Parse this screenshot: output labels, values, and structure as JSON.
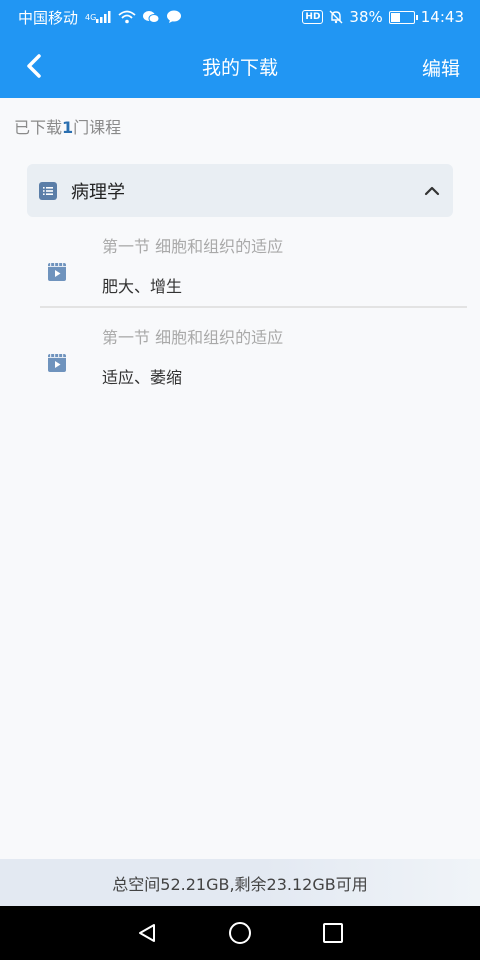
{
  "statusbar": {
    "carrier": "中国移动",
    "network": "4G",
    "battery_percent": "38%",
    "time": "14:43",
    "hd": "HD"
  },
  "header": {
    "title": "我的下载",
    "edit_label": "编辑",
    "back_icon": "chevron-left-icon"
  },
  "summary": {
    "prefix": "已下载",
    "count": "1",
    "suffix": "门课程"
  },
  "course": {
    "title": "病理学",
    "icon": "list-icon",
    "expanded": true
  },
  "lessons": [
    {
      "chapter": "第一节 细胞和组织的适应",
      "name": "肥大、增生"
    },
    {
      "chapter": "第一节 细胞和组织的适应",
      "name": "适应、萎缩"
    }
  ],
  "footer": {
    "storage_text": "总空间52.21GB,剩余23.12GB可用"
  },
  "colors": {
    "accent": "#2196f3",
    "course_card": "#e9eef3",
    "icon_blue": "#5b7ea8"
  }
}
